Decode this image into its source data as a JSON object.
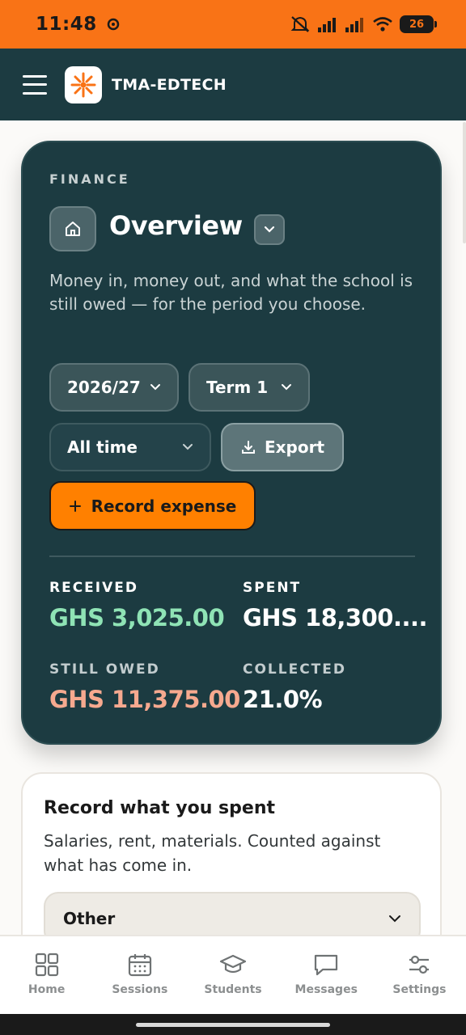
{
  "status_bar": {
    "time": "11:48",
    "battery": "26"
  },
  "header": {
    "brand": "TMA-EDTECH"
  },
  "finance": {
    "eyebrow": "FINANCE",
    "title": "Overview",
    "description": "Money in, money out, and what the school is still owed — for the period you choose.",
    "filters": {
      "year": "2026/27",
      "term": "Term 1",
      "range": "All time"
    },
    "export_label": "Export",
    "record_label": "Record expense",
    "stats": {
      "received": {
        "label": "RECEIVED",
        "value": "GHS 3,025.00"
      },
      "spent": {
        "label": "SPENT",
        "value": "GHS 18,300...."
      },
      "owed": {
        "label": "STILL OWED",
        "value": "GHS 11,375.00"
      },
      "collected": {
        "label": "COLLECTED",
        "value": "21.0%"
      }
    }
  },
  "spend": {
    "title": "Record what you spent",
    "description": "Salaries, rent, materials. Counted against what has come in.",
    "category": "Other"
  },
  "nav": {
    "items": [
      {
        "label": "Home",
        "icon": "grid-icon"
      },
      {
        "label": "Sessions",
        "icon": "calendar-icon"
      },
      {
        "label": "Students",
        "icon": "graduation-cap-icon"
      },
      {
        "label": "Messages",
        "icon": "chat-icon"
      },
      {
        "label": "Settings",
        "icon": "sliders-icon"
      }
    ]
  },
  "colors": {
    "accent": "#f97316",
    "primary": "#1c3b41",
    "positive": "#8fe3b5",
    "warning": "#f6a98f"
  }
}
